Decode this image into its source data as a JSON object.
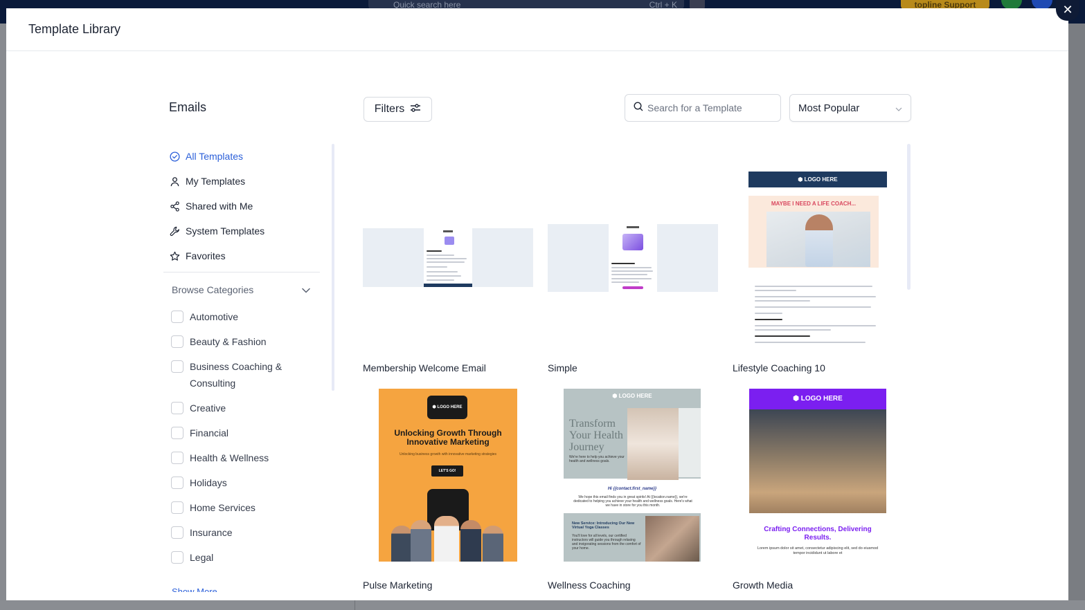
{
  "backdrop": {
    "search_placeholder": "Quick search here",
    "search_shortcut": "Ctrl + K",
    "support_label": "topline Support"
  },
  "modal": {
    "title": "Template Library",
    "close_label": "✕"
  },
  "sidebar": {
    "title": "Emails",
    "nav": [
      {
        "label": "All Templates",
        "icon": "check-circle-icon",
        "active": true
      },
      {
        "label": "My Templates",
        "icon": "user-icon",
        "active": false
      },
      {
        "label": "Shared with Me",
        "icon": "share-icon",
        "active": false
      },
      {
        "label": "System Templates",
        "icon": "wrench-icon",
        "active": false
      },
      {
        "label": "Favorites",
        "icon": "star-icon",
        "active": false
      }
    ],
    "browse_label": "Browse Categories",
    "categories": [
      "Automotive",
      "Beauty & Fashion",
      "Business Coaching & Consulting",
      "Creative",
      "Financial",
      "Health & Wellness",
      "Holidays",
      "Home Services",
      "Insurance",
      "Legal"
    ],
    "show_more": "Show More"
  },
  "toolbar": {
    "filters_label": "Filters",
    "search_placeholder": "Search for a Template",
    "sort_selected": "Most Popular"
  },
  "templates": [
    {
      "name": "Membership Welcome Email"
    },
    {
      "name": "Simple"
    },
    {
      "name": "Lifestyle Coaching 10"
    },
    {
      "name": "Pulse Marketing"
    },
    {
      "name": "Wellness Coaching"
    },
    {
      "name": "Growth Media"
    }
  ],
  "thumbs": {
    "logo_text": "LOGO HERE",
    "lifestyle_hero": "MAYBE I NEED A LIFE COACH...",
    "pulse_title": "Unlocking Growth Through Innovative Marketing",
    "pulse_sub": "Unlocking business growth with innovative marketing strategies",
    "pulse_btn": "LET'S GO!",
    "wellness_title": "Transform Your Health Journey",
    "wellness_small": "We're here to help you achieve your health and wellness goals.",
    "wellness_hi": "Hi {{contact.first_name}}",
    "wellness_body": "We hope this email finds you in great spirits! At {{location.name}}, we're dedicated to helping you achieve your health and wellness goals. Here's what we have in store for you this month.",
    "wellness_band_title": "New Service: Introducing Our New Virtual Yoga Classes",
    "wellness_band_text": "You'll love for all levels, our certified instructors will guide you through relaxing and invigorating sessions from the comfort of your home.",
    "growth_title": "Crafting Connections, Delivering Results.",
    "growth_text": "Lorem ipsum dolor sit amet, consectetur adipiscing elit, sed do eiusmod tempor incididunt ut labore et"
  },
  "colors": {
    "accent": "#2b5fd9",
    "modal_bg": "#ffffff",
    "backdrop": "#7a7d82"
  }
}
